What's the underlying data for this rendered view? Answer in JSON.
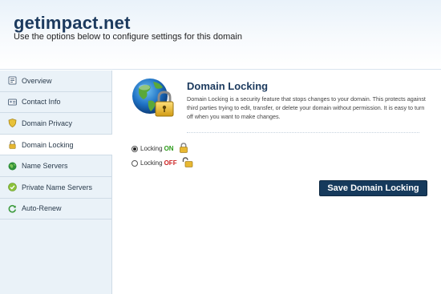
{
  "header": {
    "title": "getimpact.net",
    "subtitle": "Use the options below to configure settings for this domain"
  },
  "sidebar": {
    "items": [
      {
        "label": "Overview",
        "icon": "overview-icon"
      },
      {
        "label": "Contact Info",
        "icon": "contact-card-icon"
      },
      {
        "label": "Domain Privacy",
        "icon": "shield-icon"
      },
      {
        "label": "Domain Locking",
        "icon": "lock-icon",
        "active": true
      },
      {
        "label": "Name Servers",
        "icon": "globe-icon"
      },
      {
        "label": "Private Name Servers",
        "icon": "check-circle-icon"
      },
      {
        "label": "Auto-Renew",
        "icon": "refresh-icon"
      }
    ]
  },
  "main": {
    "title": "Domain Locking",
    "description": "Domain Locking is a security feature that stops changes to your domain. This protects against third parties trying to edit, transfer, or delete your domain without permission. It is easy to turn off when you want to make changes.",
    "options": [
      {
        "prefix": "Locking",
        "state": "ON",
        "checked": true
      },
      {
        "prefix": "Locking",
        "state": "OFF",
        "checked": false
      }
    ],
    "save_label": "Save Domain Locking"
  },
  "colors": {
    "brand": "#1c3a5e",
    "button": "#163a5c",
    "on": "#2e9c1c",
    "off": "#cc2222",
    "sidebar_bg": "#eaf2f8"
  }
}
